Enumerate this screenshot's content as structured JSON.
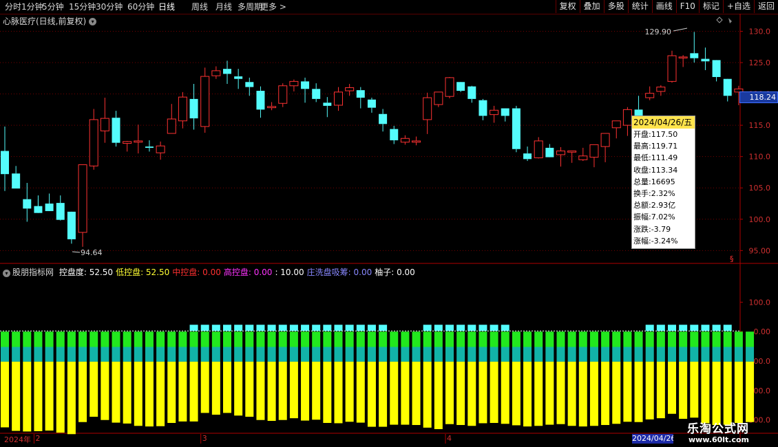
{
  "toolbar": {
    "periods": [
      "分时",
      "1分钟",
      "5分钟",
      "15分钟",
      "30分钟",
      "60分钟",
      "日线",
      "周线",
      "月线",
      "多周期",
      "更多 >"
    ],
    "active_period": "日线",
    "right_buttons": [
      "复权",
      "叠加",
      "多股",
      "统计",
      "画线",
      "F10",
      "标记",
      "+自选",
      "返回"
    ]
  },
  "main_chart": {
    "title": "心脉医疗(日线,前复权)",
    "y_axis": [
      "130.0",
      "125.0",
      "120.0",
      "115.0",
      "110.0",
      "105.0",
      "100.0",
      "95.00"
    ],
    "y_range": [
      93.5,
      131.7
    ],
    "high_label": "129.90",
    "low_label": "94.64",
    "current_price": "118.24",
    "candles": [
      [
        110.9,
        114.8,
        107.2,
        104.5
      ],
      [
        107.3,
        108.5,
        104.9,
        104.9
      ],
      [
        103.2,
        105.8,
        101.7,
        99.6
      ],
      [
        102.1,
        103.8,
        101.0,
        103.2
      ],
      [
        102.5,
        104.1,
        101.3,
        101.8
      ],
      [
        102.6,
        103.8,
        99.9,
        99.8
      ],
      [
        101.2,
        101.1,
        96.8,
        96.1
      ],
      [
        97.9,
        108.2,
        108.7,
        95.6
      ],
      [
        108.5,
        117.6,
        115.9,
        107.9
      ],
      [
        114.1,
        119.4,
        116.1,
        112.2
      ],
      [
        116.2,
        117.3,
        112.2,
        111.6
      ],
      [
        112.1,
        112.5,
        112.4,
        110.8
      ],
      [
        112.3,
        115.1,
        112.5,
        110.5
      ],
      [
        111.6,
        112.6,
        111.4,
        110.8
      ],
      [
        110.6,
        112.4,
        111.7,
        109.5
      ],
      [
        113.7,
        118.4,
        116.0,
        113.8
      ],
      [
        115.7,
        120.3,
        119.5,
        114.5
      ],
      [
        119.2,
        121.6,
        116.1,
        114.3
      ],
      [
        114.8,
        124.2,
        122.8,
        113.8
      ],
      [
        122.9,
        124.4,
        123.7,
        122.4
      ],
      [
        124.0,
        125.3,
        123.2,
        121.6
      ],
      [
        122.8,
        124.0,
        122.4,
        120.8
      ],
      [
        121.9,
        122.6,
        121.1,
        119.7
      ],
      [
        120.5,
        121.2,
        117.5,
        116.2
      ],
      [
        117.8,
        118.7,
        118.0,
        117.4
      ],
      [
        118.5,
        121.7,
        121.3,
        117.9
      ],
      [
        121.3,
        122.3,
        122.0,
        120.4
      ],
      [
        122.0,
        122.6,
        120.8,
        118.6
      ],
      [
        120.8,
        121.7,
        119.2,
        118.7
      ],
      [
        118.6,
        119.5,
        118.1,
        116.3
      ],
      [
        118.2,
        121.1,
        120.3,
        117.3
      ],
      [
        120.5,
        121.6,
        121.0,
        119.7
      ],
      [
        120.6,
        121.1,
        119.4,
        117.7
      ],
      [
        119.1,
        119.4,
        117.8,
        117.0
      ],
      [
        116.8,
        117.6,
        115.2,
        114.0
      ],
      [
        114.4,
        114.9,
        112.6,
        112.0
      ],
      [
        112.3,
        113.4,
        112.9,
        111.9
      ],
      [
        112.3,
        113.2,
        112.5,
        111.8
      ],
      [
        115.9,
        120.2,
        119.4,
        113.6
      ],
      [
        118.3,
        119.9,
        120.3,
        117.9
      ],
      [
        119.6,
        122.7,
        122.6,
        119.3
      ],
      [
        121.9,
        121.8,
        120.5,
        120.3
      ],
      [
        121.2,
        121.3,
        119.2,
        118.6
      ],
      [
        119.0,
        119.2,
        116.5,
        115.8
      ],
      [
        116.7,
        118.1,
        117.4,
        115.4
      ],
      [
        117.7,
        117.5,
        116.5,
        115.6
      ],
      [
        117.7,
        118.1,
        111.2,
        110.7
      ],
      [
        110.5,
        111.6,
        109.6,
        109.3
      ],
      [
        109.8,
        113.1,
        112.5,
        109.7
      ],
      [
        111.4,
        112.0,
        109.9,
        110.1
      ],
      [
        110.3,
        111.5,
        110.9,
        108.4
      ],
      [
        110.7,
        110.9,
        110.9,
        109.0
      ],
      [
        109.5,
        111.4,
        110.1,
        109.3
      ],
      [
        109.9,
        111.9,
        111.9,
        108.3
      ],
      [
        111.6,
        113.7,
        113.7,
        109.1
      ],
      [
        114.6,
        115.4,
        115.7,
        112.9
      ],
      [
        115.0,
        117.9,
        117.5,
        113.3
      ],
      [
        117.5,
        119.7,
        113.3,
        111.5
      ],
      [
        119.4,
        121.2,
        120.1,
        119.0
      ],
      [
        120.4,
        121.4,
        121.1,
        119.7
      ],
      [
        122.0,
        126.9,
        126.1,
        121.8
      ],
      [
        125.8,
        126.2,
        125.9,
        124.3
      ],
      [
        126.5,
        129.9,
        125.7,
        125.0
      ],
      [
        125.6,
        127.4,
        125.2,
        123.8
      ],
      [
        125.4,
        125.3,
        122.7,
        122.0
      ],
      [
        122.4,
        122.0,
        119.7,
        118.8
      ],
      [
        120.3,
        121.3,
        120.8,
        118.2
      ]
    ]
  },
  "tooltip": {
    "date": "2024/04/26/五",
    "rows": [
      "开盘:117.50",
      "最高:119.71",
      "最低:111.49",
      "收盘:113.34",
      "总量:16695",
      "换手:2.32%",
      "总额:2.93亿",
      "振幅:7.02%",
      "涨跌:-3.79",
      "涨幅:-3.24%"
    ]
  },
  "indicator": {
    "name": "股朋指标网",
    "items": [
      {
        "text": "控盘度: 52.50",
        "color": "#ffffff"
      },
      {
        "text": "低控盘: 52.50",
        "color": "#ffff33"
      },
      {
        "text": "中控盘: 0.00",
        "color": "#ff3030"
      },
      {
        "text": "高控盘: 0.00",
        "color": "#ff33ff"
      },
      {
        "text": ": 10.00",
        "color": "#ffffff"
      },
      {
        "text": "庄洗盘吸筹: 0.00",
        "color": "#8888ff"
      },
      {
        "text": "柚子: 0.00",
        "color": "#ffffff"
      }
    ],
    "y_axis": [
      "100.0",
      "0.00",
      "-100.0",
      "-200.0",
      "-300.0"
    ],
    "y_range": [
      -345,
      185
    ],
    "green_top": 0,
    "teal_top": -52,
    "yellow_top": -102,
    "yellow_bottoms": [
      -325,
      -337,
      -339,
      -338,
      -336,
      -343,
      -348,
      -307,
      -289,
      -300,
      -309,
      -312,
      -320,
      -322,
      -321,
      -310,
      -305,
      -305,
      -276,
      -282,
      -276,
      -285,
      -289,
      -300,
      -303,
      -300,
      -294,
      -302,
      -299,
      -310,
      -311,
      -306,
      -309,
      -323,
      -323,
      -316,
      -316,
      -317,
      -326,
      -331,
      -314,
      -317,
      -320,
      -311,
      -310,
      -313,
      -318,
      -322,
      -320,
      -316,
      -314,
      -320,
      -322,
      -320,
      -317,
      -313,
      -306,
      -307,
      -298,
      -294,
      -279,
      -296,
      -292,
      -311,
      -317,
      -316,
      -310,
      -307
    ],
    "cyan_marks": [
      17,
      18,
      19,
      20,
      21,
      22,
      23,
      24,
      25,
      26,
      27,
      28,
      29,
      30,
      31,
      32,
      33,
      34,
      38,
      39,
      40,
      41,
      42,
      43,
      44,
      45,
      58,
      59,
      60,
      61,
      62,
      63,
      64,
      65
    ]
  },
  "date_axis": {
    "labels": [
      {
        "text": "2024年",
        "i": 0
      },
      {
        "text": "2",
        "i": 3
      },
      {
        "text": "3",
        "i": 18
      },
      {
        "text": "4",
        "i": 40
      }
    ],
    "highlight": "2024/04/26"
  },
  "watermark": {
    "line1": "乐淘公式网",
    "line2": "www.60lt.com"
  },
  "colors": {
    "up": "#ff3232",
    "down": "#54fcfc",
    "grid": "#7a0000",
    "axis": "#b00000"
  }
}
